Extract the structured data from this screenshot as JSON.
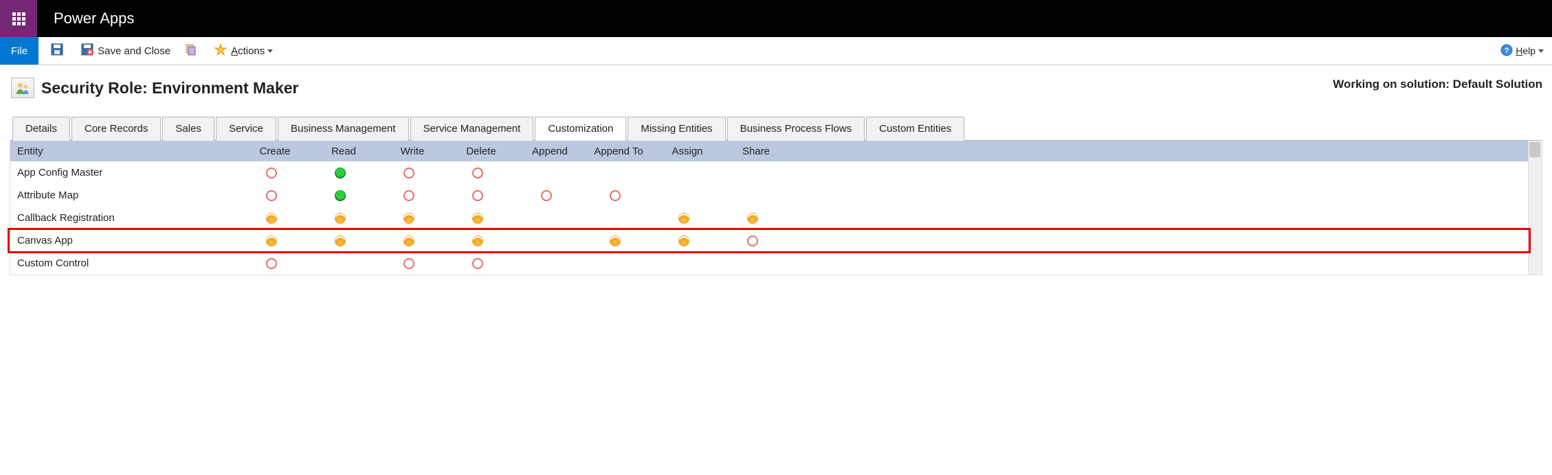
{
  "header": {
    "brand": "Power Apps"
  },
  "ribbon": {
    "file": "File",
    "save_and_close": "Save and Close",
    "actions": "Actions",
    "help": "Help"
  },
  "page": {
    "title": "Security Role: Environment Maker",
    "solution": "Working on solution: Default Solution"
  },
  "tabs": [
    "Details",
    "Core Records",
    "Sales",
    "Service",
    "Business Management",
    "Service Management",
    "Customization",
    "Missing Entities",
    "Business Process Flows",
    "Custom Entities"
  ],
  "active_tab": 6,
  "grid": {
    "columns": [
      "Entity",
      "Create",
      "Read",
      "Write",
      "Delete",
      "Append",
      "Append To",
      "Assign",
      "Share"
    ],
    "rows": [
      {
        "entity": "App Config Master",
        "perms": [
          "none",
          "org",
          "none",
          "none",
          "",
          "",
          "",
          ""
        ]
      },
      {
        "entity": "Attribute Map",
        "perms": [
          "none",
          "org",
          "none",
          "none",
          "none",
          "none",
          "",
          ""
        ]
      },
      {
        "entity": "Callback Registration",
        "perms": [
          "user",
          "user",
          "user",
          "user",
          "",
          "",
          "user",
          "user"
        ]
      },
      {
        "entity": "Canvas App",
        "perms": [
          "user",
          "user",
          "user",
          "user",
          "",
          "user",
          "user",
          "none"
        ],
        "highlight": true
      },
      {
        "entity": "Custom Control",
        "perms": [
          "none",
          "",
          "none",
          "none",
          "",
          "",
          "",
          ""
        ]
      }
    ]
  }
}
